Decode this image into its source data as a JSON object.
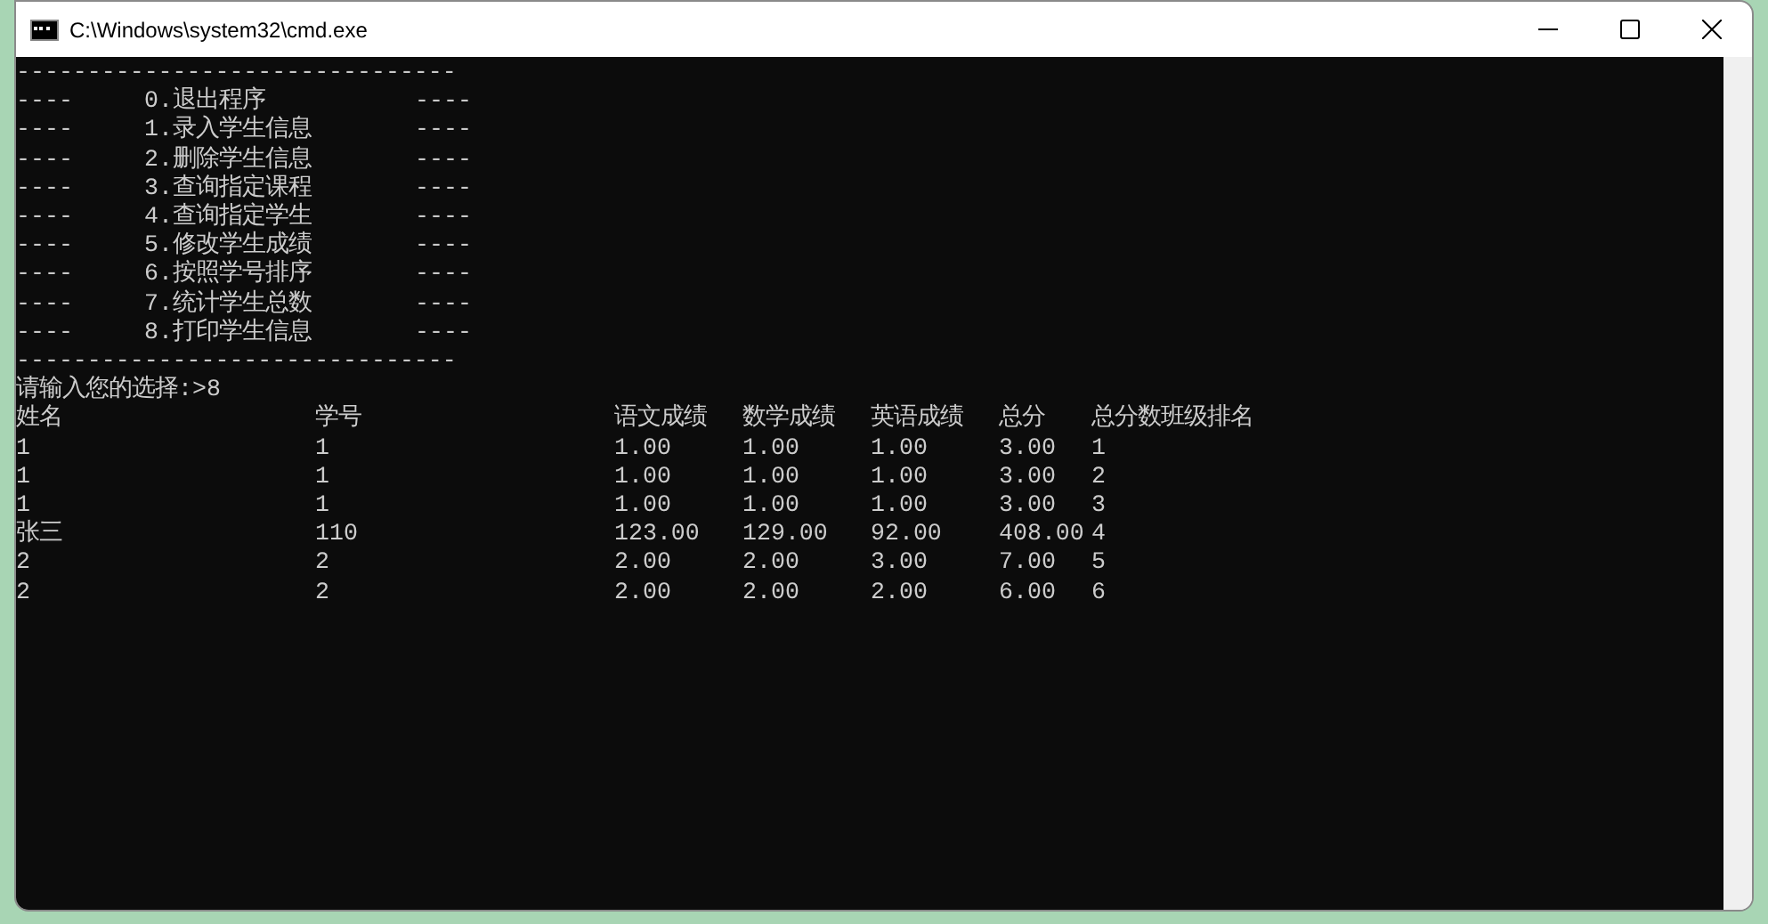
{
  "window": {
    "title": "C:\\Windows\\system32\\cmd.exe"
  },
  "console": {
    "rule_top": "-------------------------------",
    "menu": [
      {
        "left": "----",
        "label": "0.退出程序",
        "right": "----"
      },
      {
        "left": "----",
        "label": "1.录入学生信息",
        "right": "----"
      },
      {
        "left": "----",
        "label": "2.删除学生信息",
        "right": "----"
      },
      {
        "left": "----",
        "label": "3.查询指定课程",
        "right": "----"
      },
      {
        "left": "----",
        "label": "4.查询指定学生",
        "right": "----"
      },
      {
        "left": "----",
        "label": "5.修改学生成绩",
        "right": "----"
      },
      {
        "left": "----",
        "label": "6.按照学号排序",
        "right": "----"
      },
      {
        "left": "----",
        "label": "7.统计学生总数",
        "right": "----"
      },
      {
        "left": "----",
        "label": "8.打印学生信息",
        "right": "----"
      }
    ],
    "rule_bottom": "-------------------------------",
    "prompt": "请输入您的选择:>8",
    "table": {
      "columns": [
        "姓名",
        "学号",
        "语文成绩",
        "数学成绩",
        "英语成绩",
        "总分",
        "总分数班级排名"
      ],
      "rows": [
        [
          "1",
          "1",
          "1.00",
          "1.00",
          "1.00",
          "3.00",
          "1"
        ],
        [
          "1",
          "1",
          "1.00",
          "1.00",
          "1.00",
          "3.00",
          "2"
        ],
        [
          "1",
          "1",
          "1.00",
          "1.00",
          "1.00",
          "3.00",
          "3"
        ],
        [
          "张三",
          "110",
          "123.00",
          "129.00",
          "92.00",
          "408.00",
          "4"
        ],
        [
          "2",
          "2",
          "2.00",
          "2.00",
          "3.00",
          "7.00",
          "5"
        ],
        [
          "2",
          "2",
          "2.00",
          "2.00",
          "2.00",
          "6.00",
          "6"
        ]
      ]
    }
  }
}
